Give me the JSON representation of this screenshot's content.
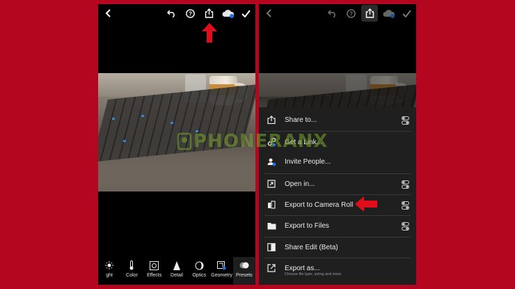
{
  "left_screen": {
    "toolbar_icons": [
      "back-icon",
      "undo-icon",
      "help-icon",
      "share-icon",
      "cloud-sync-icon",
      "checkmark-icon"
    ],
    "bottom_tools": [
      {
        "label": "ght",
        "icon": "light-icon"
      },
      {
        "label": "Color",
        "icon": "thermometer-icon"
      },
      {
        "label": "Effects",
        "icon": "effects-icon"
      },
      {
        "label": "Detail",
        "icon": "detail-icon"
      },
      {
        "label": "Optics",
        "icon": "optics-icon"
      },
      {
        "label": "Geometry",
        "icon": "geometry-icon"
      },
      {
        "label": "Presets",
        "icon": "presets-icon"
      }
    ],
    "active_tool": "Presets"
  },
  "right_screen": {
    "toolbar_icons": [
      "back-icon",
      "undo-icon",
      "help-icon",
      "share-icon",
      "cloud-sync-icon",
      "checkmark-icon"
    ],
    "share_menu": [
      {
        "label": "Share to...",
        "icon": "share-out-icon",
        "has_settings": true
      },
      {
        "label": "Get a Link...",
        "icon": "link-icon",
        "has_settings": false
      },
      {
        "label": "Invite People...",
        "icon": "invite-people-icon",
        "has_settings": false
      },
      {
        "label": "Open in...",
        "icon": "open-in-icon",
        "has_settings": true
      },
      {
        "label": "Export to Camera Roll",
        "icon": "camera-roll-icon",
        "has_settings": true
      },
      {
        "label": "Export to Files",
        "icon": "folder-icon",
        "has_settings": true
      },
      {
        "label": "Share Edit (Beta)",
        "icon": "share-edit-icon",
        "has_settings": false
      },
      {
        "label": "Export as...",
        "icon": "export-as-icon",
        "has_settings": false,
        "subtitle": "Choose file type, sizing and more"
      }
    ]
  },
  "watermark": "PHONERANX",
  "colors": {
    "background": "#b5061f",
    "highlight_arrow": "#e10d1a",
    "menu_bg": "#1f1f1f",
    "cloud_blue": "#1b73e8"
  }
}
